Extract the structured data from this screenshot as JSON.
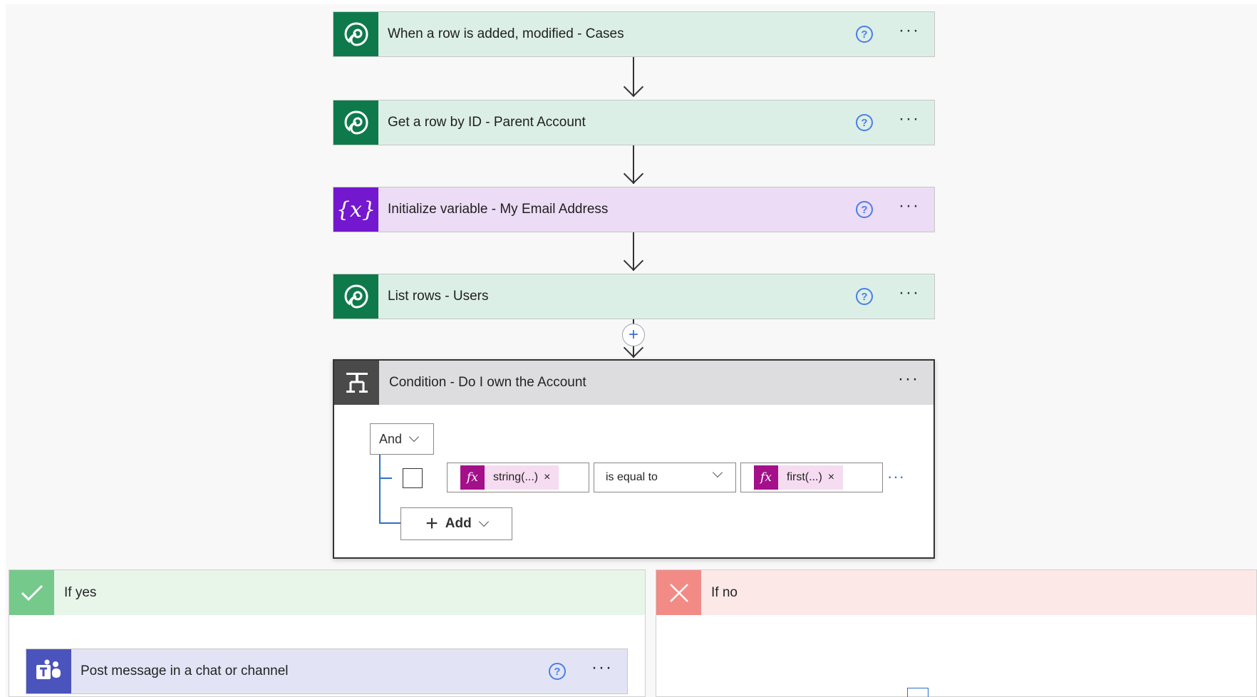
{
  "steps": [
    {
      "title": "When a row is added, modified - Cases",
      "icon": "dataverse-icon",
      "color": "#0e7a4c"
    },
    {
      "title": "Get a row by ID - Parent Account",
      "icon": "dataverse-icon",
      "color": "#0e7a4c"
    },
    {
      "title": "Initialize variable - My Email Address",
      "icon": "variable-icon",
      "color": "#7318cf"
    },
    {
      "title": "List rows - Users",
      "icon": "dataverse-icon",
      "color": "#0e7a4c"
    }
  ],
  "variable_glyph": "{x}",
  "help_glyph": "?",
  "more_glyph": "···",
  "condition": {
    "title": "Condition - Do I own the Account",
    "group_operator": "And",
    "left_token": "string(...)",
    "operator": "is equal to",
    "right_token": "first(...)",
    "fx_glyph": "fx",
    "remove_glyph": "×",
    "add_label": "Add"
  },
  "branches": {
    "yes_label": "If yes",
    "no_label": "If no",
    "yes_action": "Post message in a chat or channel"
  },
  "colors": {
    "yes": "#75c98a",
    "no": "#f28b86",
    "teams": "#4b53bc",
    "fx": "#a3108a"
  }
}
